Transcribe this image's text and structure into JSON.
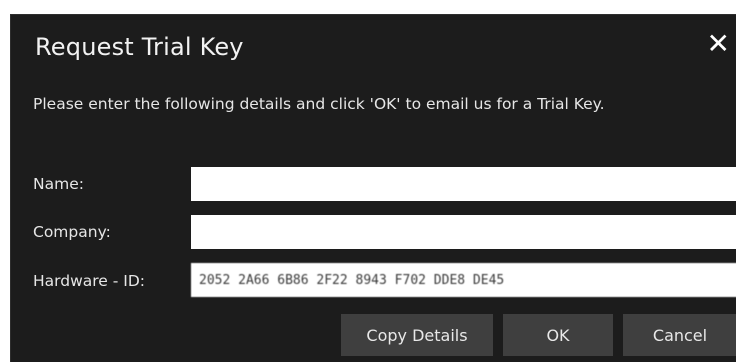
{
  "dialog": {
    "title": "Request Trial Key",
    "message": "Please enter the following details and click 'OK' to email us for a Trial Key."
  },
  "form": {
    "name_label": "Name:",
    "name_value": "",
    "company_label": "Company:",
    "company_value": "",
    "hardware_label": "Hardware - ID:",
    "hardware_value": "2052 2A66 6B86 2F22 8943 F702 DDE8 DE45"
  },
  "buttons": {
    "copy": "Copy Details",
    "ok": "OK",
    "cancel": "Cancel"
  },
  "icons": {
    "close": "close-icon"
  },
  "colors": {
    "background": "#1c1c1c",
    "button": "#3f3f3f",
    "text": "#e6e6e6"
  }
}
